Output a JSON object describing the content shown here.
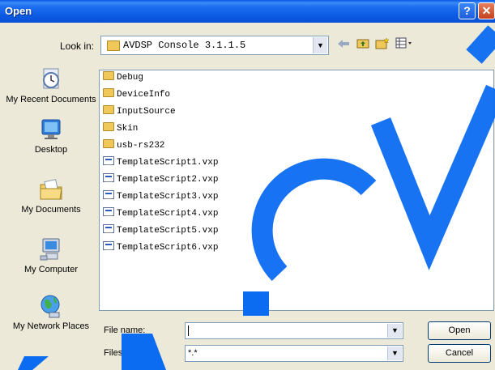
{
  "window": {
    "title": "Open",
    "help_label": "?",
    "close_label": "✕"
  },
  "lookin": {
    "label": "Look in:",
    "value": "AVDSP Console 3.1.1.5",
    "dropdown_icon": "chevron-down-icon"
  },
  "toolbar": {
    "items": [
      "back-icon",
      "up-folder-icon",
      "new-folder-icon",
      "views-menu-icon"
    ]
  },
  "places": [
    {
      "label": "My Recent Documents",
      "icon": "recent-documents-icon"
    },
    {
      "label": "Desktop",
      "icon": "desktop-icon"
    },
    {
      "label": "My Documents",
      "icon": "my-documents-icon"
    },
    {
      "label": "My Computer",
      "icon": "my-computer-icon"
    },
    {
      "label": "My Network Places",
      "icon": "network-places-icon"
    }
  ],
  "files": [
    {
      "name": "Debug",
      "type": "folder"
    },
    {
      "name": "DeviceInfo",
      "type": "folder"
    },
    {
      "name": "InputSource",
      "type": "folder"
    },
    {
      "name": "Skin",
      "type": "folder"
    },
    {
      "name": "usb-rs232",
      "type": "folder"
    },
    {
      "name": "TemplateScript1.vxp",
      "type": "file"
    },
    {
      "name": "TemplateScript2.vxp",
      "type": "file"
    },
    {
      "name": "TemplateScript3.vxp",
      "type": "file"
    },
    {
      "name": "TemplateScript4.vxp",
      "type": "file"
    },
    {
      "name": "TemplateScript5.vxp",
      "type": "file"
    },
    {
      "name": "TemplateScript6.vxp",
      "type": "file"
    }
  ],
  "filename": {
    "label": "File name:",
    "value": ""
  },
  "filetype": {
    "label": "Files of type:",
    "value": "*.*"
  },
  "buttons": {
    "open": "Open",
    "cancel": "Cancel"
  },
  "watermark": {
    "color": "#0b6cf2"
  }
}
